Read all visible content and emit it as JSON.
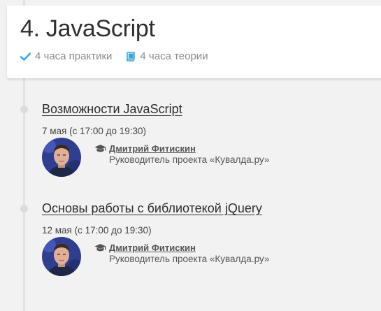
{
  "header": {
    "title": "4. JavaScript",
    "practice": "4 часа практики",
    "theory": "4 часа теории",
    "accent_color": "#3aa7de"
  },
  "lessons": [
    {
      "title": "Возможности JavaScript",
      "date": "7 мая (с 17:00 до 19:30)",
      "teacher_name": "Дмитрий Фитискин",
      "teacher_role": "Руководитель проекта «Кувалда.ру»"
    },
    {
      "title": "Основы работы с библиотекой jQuery",
      "date": "12 мая (с 17:00 до 19:30)",
      "teacher_name": "Дмитрий Фитискин",
      "teacher_role": "Руководитель проекта «Кувалда.ру»"
    }
  ]
}
